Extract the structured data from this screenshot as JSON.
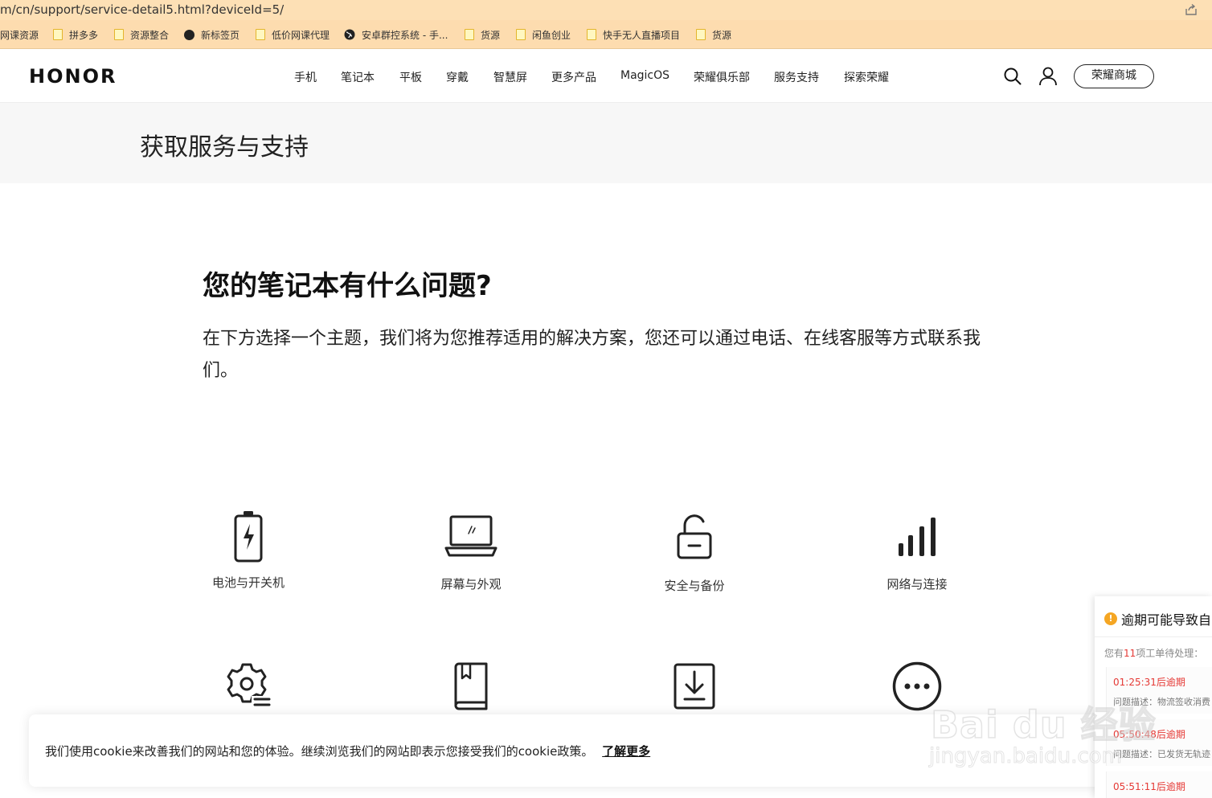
{
  "browser": {
    "url": "m/cn/support/service-detail5.html?deviceId=5/",
    "bookmarks": [
      {
        "label": "网课资源",
        "icon": "none"
      },
      {
        "label": "拼多多",
        "icon": "folder-icon"
      },
      {
        "label": "资源整合",
        "icon": "folder-icon"
      },
      {
        "label": "新标签页",
        "icon": "dot-icon"
      },
      {
        "label": "低价网课代理",
        "icon": "folder-icon"
      },
      {
        "label": "安卓群控系统 - 手...",
        "icon": "globe-icon"
      },
      {
        "label": "货源",
        "icon": "folder-icon"
      },
      {
        "label": "闲鱼创业",
        "icon": "folder-icon"
      },
      {
        "label": "快手无人直播项目",
        "icon": "folder-icon"
      },
      {
        "label": "货源",
        "icon": "folder-icon"
      }
    ]
  },
  "header": {
    "logo": "HONOR",
    "nav": [
      "手机",
      "笔记本",
      "平板",
      "穿戴",
      "智慧屏",
      "更多产品",
      "MagicOS",
      "荣耀俱乐部",
      "服务支持",
      "探索荣耀"
    ],
    "store_button": "荣耀商城"
  },
  "band": {
    "title": "获取服务与支持"
  },
  "main": {
    "heading": "您的笔记本有什么问题?",
    "description": "在下方选择一个主题，我们将为您推荐适用的解决方案，您还可以通过电话、在线客服等方式联系我们。",
    "categories": [
      {
        "label": "电池与开关机",
        "icon": "battery-icon"
      },
      {
        "label": "屏幕与外观",
        "icon": "laptop-icon"
      },
      {
        "label": "安全与备份",
        "icon": "unlock-icon"
      },
      {
        "label": "网络与连接",
        "icon": "signal-icon"
      },
      {
        "label": "",
        "icon": "settings-gear-icon"
      },
      {
        "label": "",
        "icon": "manual-book-icon"
      },
      {
        "label": "",
        "icon": "download-icon"
      },
      {
        "label": "",
        "icon": "more-icon"
      }
    ]
  },
  "cookie": {
    "text": "我们使用cookie来改善我们的网站和您的体验。继续浏览我们的网站即表示您接受我们的cookie政策。",
    "link": "了解更多"
  },
  "notification": {
    "title": "逾期可能导致自",
    "sub_prefix": "您有",
    "sub_count": "11",
    "sub_suffix": "项工单待处理：",
    "items": [
      {
        "time": "01:25:31后逾期",
        "desc": "问题描述：物流签收消费"
      },
      {
        "time": "05:50:48后逾期",
        "desc": "问题描述：已发货无轨迹"
      },
      {
        "time": "05:51:11后逾期",
        "desc": ""
      }
    ]
  },
  "watermark": {
    "word": "Bai du 经验",
    "sub": "jingyan.baidu.com"
  }
}
